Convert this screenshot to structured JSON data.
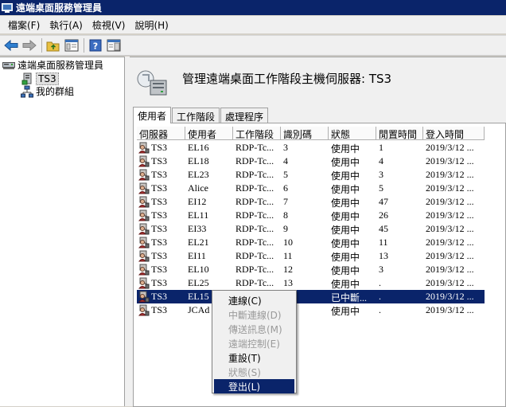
{
  "window": {
    "title": "遠端桌面服務管理員"
  },
  "menu": [
    "檔案(F)",
    "執行(A)",
    "檢視(V)",
    "說明(H)"
  ],
  "tree": {
    "root": "遠端桌面服務管理員",
    "ts3": "TS3",
    "groups": "我的群組"
  },
  "main": {
    "title": "管理遠端桌面工作階段主機伺服器: TS3",
    "tabs": [
      "使用者",
      "工作階段",
      "處理程序"
    ],
    "columns": [
      "伺服器",
      "使用者",
      "工作階段",
      "識別碼",
      "狀態",
      "閒置時間",
      "登入時間"
    ],
    "rows": [
      [
        "TS3",
        "EL16",
        "RDP-Tc...",
        "3",
        "使用中",
        "1",
        "2019/3/12 ..."
      ],
      [
        "TS3",
        "EL18",
        "RDP-Tc...",
        "4",
        "使用中",
        "4",
        "2019/3/12 ..."
      ],
      [
        "TS3",
        "EL23",
        "RDP-Tc...",
        "5",
        "使用中",
        "3",
        "2019/3/12 ..."
      ],
      [
        "TS3",
        "Alice",
        "RDP-Tc...",
        "6",
        "使用中",
        "5",
        "2019/3/12 ..."
      ],
      [
        "TS3",
        "EI12",
        "RDP-Tc...",
        "7",
        "使用中",
        "47",
        "2019/3/12 ..."
      ],
      [
        "TS3",
        "EL11",
        "RDP-Tc...",
        "8",
        "使用中",
        "26",
        "2019/3/12 ..."
      ],
      [
        "TS3",
        "EI33",
        "RDP-Tc...",
        "9",
        "使用中",
        "45",
        "2019/3/12 ..."
      ],
      [
        "TS3",
        "EL21",
        "RDP-Tc...",
        "10",
        "使用中",
        "11",
        "2019/3/12 ..."
      ],
      [
        "TS3",
        "EI11",
        "RDP-Tc...",
        "11",
        "使用中",
        "13",
        "2019/3/12 ..."
      ],
      [
        "TS3",
        "EL10",
        "RDP-Tc...",
        "12",
        "使用中",
        "3",
        "2019/3/12 ..."
      ],
      [
        "TS3",
        "EL25",
        "RDP-Tc...",
        "13",
        "使用中",
        ".",
        "2019/3/12 ..."
      ],
      [
        "TS3",
        "EL15",
        "",
        "",
        "已中斷...",
        ".",
        "2019/3/12 ..."
      ],
      [
        "TS3",
        "JCAd",
        "",
        "",
        "使用中",
        ".",
        "2019/3/12 ..."
      ]
    ],
    "selected_row": 11
  },
  "context_menu": {
    "connect": "連線(C)",
    "disconnect": "中斷連線(D)",
    "send_message": "傳送訊息(M)",
    "remote_control": "遠端控制(E)",
    "reset": "重設(T)",
    "status": "狀態(S)",
    "logoff": "登出(L)"
  },
  "colors": {
    "titlebar": "#0a246a",
    "selection": "#0a246a"
  }
}
